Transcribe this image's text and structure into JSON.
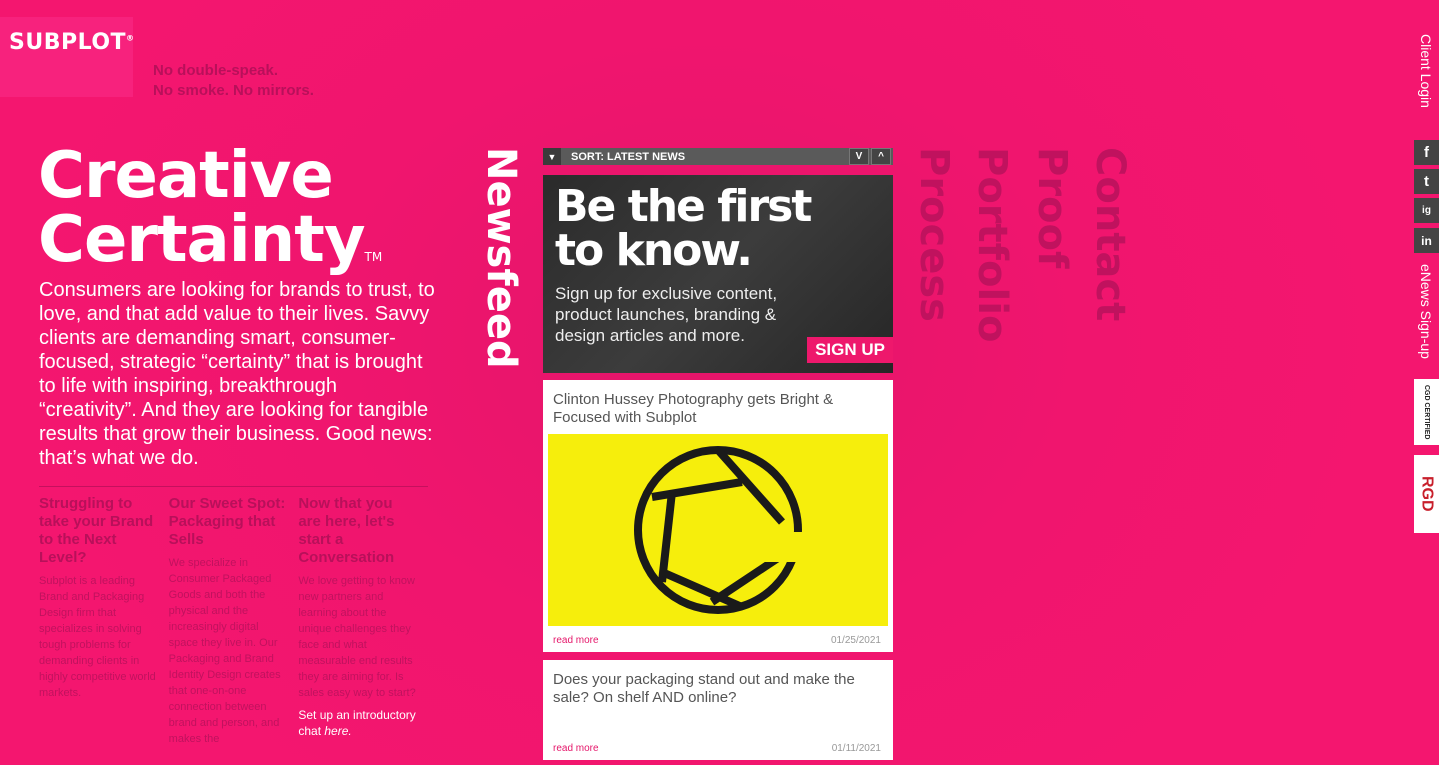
{
  "brand": {
    "logo_text": "SUBPLOT",
    "tagline_line1": "No double-speak.",
    "tagline_line2": "No smoke. No mirrors."
  },
  "hero": {
    "title_line1": "Creative",
    "title_line2": "Certainty",
    "tm": "TM",
    "body": "Consumers are looking for brands to trust, to love, and that add value to their lives. Savvy clients are demanding smart, consumer-focused, strategic “certainty” that is brought to life with inspiring, breakthrough “creativity”. And they are looking for tangible results that grow their business. Good news: that’s what we do."
  },
  "columns": [
    {
      "title": "Struggling to take your Brand to the Next Level?",
      "text": "Subplot is a leading Brand and Packaging Design firm that specializes in solving tough problems for demanding clients in highly competitive world markets."
    },
    {
      "title": "Our Sweet Spot: Packaging that Sells",
      "text": "We specialize in Consumer Packaged Goods and both the physical and the increasingly digital space they live in. Our Packaging and Brand Identity Design creates that one-on-one connection between brand and person, and makes the"
    },
    {
      "title": "Now that you are here, let's start a Conversation",
      "text": "We love getting to know new partners and learning about the unique challenges they face and what measurable end results they are aiming for. Is sales easy way to start?",
      "cta_text": "Set up an introductory chat",
      "cta_link": "here."
    }
  ],
  "newsfeed": {
    "label": "Newsfeed",
    "sort_label": "SORT: LATEST NEWS",
    "sort_caret": "▼",
    "down_btn": "V",
    "up_btn": "^",
    "promo": {
      "heading_line1": "Be the first",
      "heading_line2": "to know.",
      "text": "Sign up for exclusive content, product launches, branding & design articles and more.",
      "button": "SIGN UP"
    },
    "cards": [
      {
        "title": "Clinton Hussey Photography gets Bright & Focused with Subplot",
        "read_more": "read more",
        "date": "01/25/2021"
      },
      {
        "title": "Does your packaging stand out and make the sale? On shelf AND online?",
        "read_more": "read more",
        "date": "01/11/2021"
      }
    ]
  },
  "nav": [
    "Process",
    "Portfolio",
    "Proof",
    "Contact"
  ],
  "rail": {
    "client_login": "Client Login",
    "social": [
      "f",
      "t",
      "ig",
      "in"
    ],
    "enews": "eNews Sign-up",
    "cgd": "CGD CERTIFIED",
    "rgd": "RGD"
  },
  "colors": {
    "background": "#f0156e",
    "accent_dark": "#b8105a",
    "promo_button": "#ee186c",
    "photo_yellow": "#f6ee0c"
  }
}
